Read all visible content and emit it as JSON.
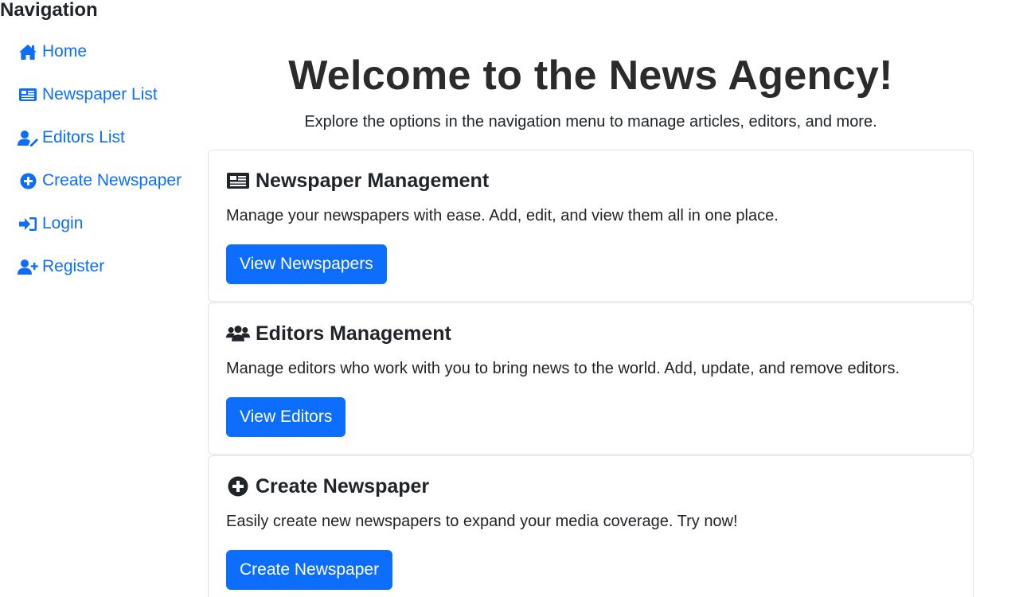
{
  "sidebar": {
    "title": "Navigation",
    "items": [
      {
        "label": "Home",
        "icon": "home-icon"
      },
      {
        "label": "Newspaper List",
        "icon": "newspaper-icon"
      },
      {
        "label": "Editors List",
        "icon": "user-edit-icon"
      },
      {
        "label": "Create Newspaper",
        "icon": "plus-circle-icon"
      },
      {
        "label": "Login",
        "icon": "sign-in-icon"
      },
      {
        "label": "Register",
        "icon": "user-plus-icon"
      }
    ]
  },
  "main": {
    "title": "Welcome to the News Agency!",
    "subtitle": "Explore the options in the navigation menu to manage articles, editors, and more.",
    "cards": [
      {
        "title": "Newspaper Management",
        "icon": "newspaper-icon",
        "text": "Manage your newspapers with ease. Add, edit, and view them all in one place.",
        "button": "View Newspapers"
      },
      {
        "title": "Editors Management",
        "icon": "users-icon",
        "text": "Manage editors who work with you to bring news to the world. Add, update, and remove editors.",
        "button": "View Editors"
      },
      {
        "title": "Create Newspaper",
        "icon": "plus-circle-icon",
        "text": "Easily create new newspapers to expand your media coverage. Try now!",
        "button": "Create Newspaper"
      }
    ]
  },
  "colors": {
    "link": "#0d6efd",
    "button_bg": "#0d6efd",
    "button_text": "#ffffff",
    "card_border": "#dee2e6",
    "text": "#212529"
  }
}
